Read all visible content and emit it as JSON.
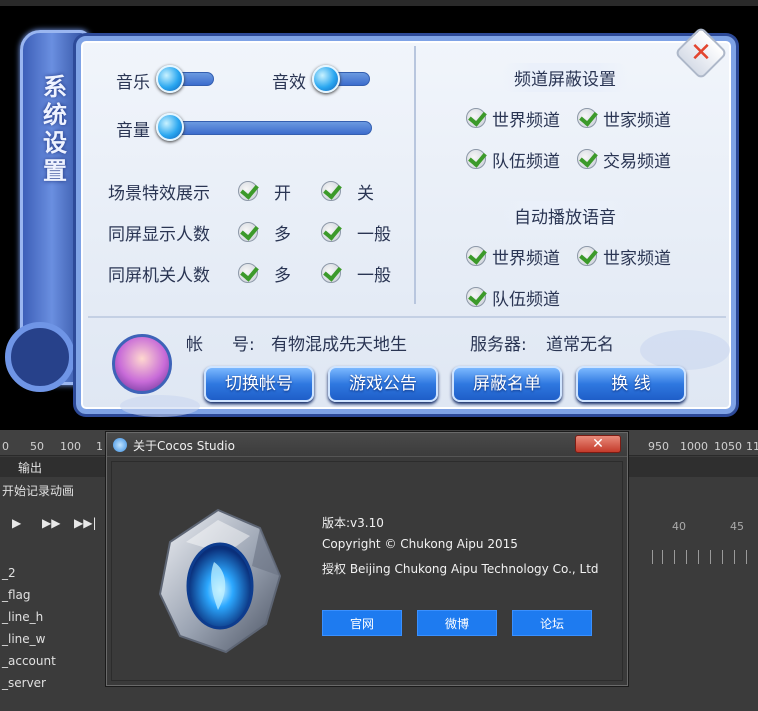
{
  "game": {
    "scroll_title": "系统设置",
    "sound": {
      "music_label": "音乐",
      "effects_label": "音效",
      "volume_label": "音量"
    },
    "options": [
      {
        "label": "场景特效展示",
        "opt1": "开",
        "opt2": "关"
      },
      {
        "label": "同屏显示人数",
        "opt1": "多",
        "opt2": "一般"
      },
      {
        "label": "同屏机关人数",
        "opt1": "多",
        "opt2": "一般"
      }
    ],
    "channel_block": {
      "title": "频道屏蔽设置",
      "items": [
        "世界频道",
        "世家频道",
        "队伍频道",
        "交易频道"
      ]
    },
    "auto_voice": {
      "title": "自动播放语音",
      "items": [
        "世界频道",
        "世家频道",
        "队伍频道"
      ]
    },
    "account": {
      "label": "帐",
      "label2": "号:",
      "value": "有物混成先天地生",
      "server_label": "服务器:",
      "server_value": "道常无名"
    },
    "buttons": [
      "切换帐号",
      "游戏公告",
      "屏蔽名单",
      "换 线"
    ],
    "close_symbol": "✕"
  },
  "editor": {
    "ruler_ticks": [
      "0",
      "50",
      "100",
      "1",
      "950",
      "1000",
      "1050",
      "11"
    ],
    "tab_label": "输出",
    "record_label": "开始记录动画",
    "play_controls": [
      "▶",
      "▶▶",
      "▶▶|"
    ],
    "layers": [
      "_2",
      "_flag",
      "_line_h",
      "_line_w",
      "_account",
      "_server"
    ],
    "timeline_numbers": [
      "40",
      "45"
    ]
  },
  "dialog": {
    "title": "关于Cocos Studio",
    "close_symbol": "✕",
    "version": "版本:v3.10",
    "copyright": "Copyright © Chukong Aipu 2015",
    "license": "授权 Beijing Chukong Aipu Technology Co., Ltd",
    "buttons": [
      "官网",
      "微博",
      "论坛"
    ]
  },
  "colors": {
    "panel_border": "#7fa3e6",
    "button_blue": "#2f78e0",
    "check_green": "#3c9a2a",
    "dialog_button": "#1e7bf0"
  }
}
